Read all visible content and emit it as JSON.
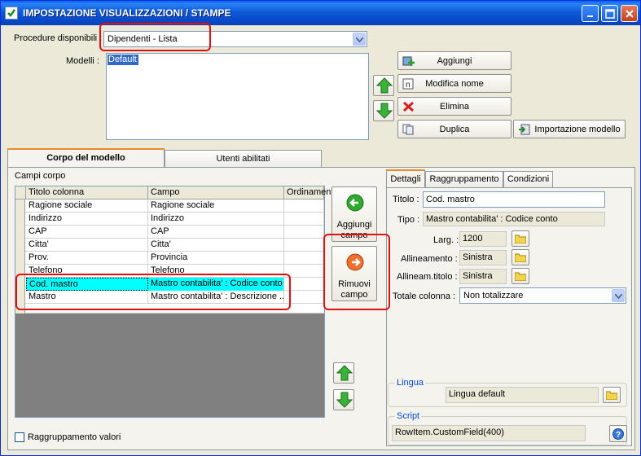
{
  "window": {
    "title": "IMPOSTAZIONE VISUALIZZAZIONI / STAMPE",
    "icon": "checkbox-icon"
  },
  "procedure": {
    "label": "Procedure disponibili :",
    "value": "Dipendenti - Lista"
  },
  "modelli": {
    "label": "Modelli :",
    "items": [
      "Default"
    ]
  },
  "buttons": {
    "aggiungi": "Aggiungi",
    "modifica_nome": "Modifica nome",
    "elimina": "Elimina",
    "duplica": "Duplica",
    "importazione": "Importazione modello"
  },
  "tabs": [
    "Corpo del modello",
    "Utenti abilitati"
  ],
  "campi": {
    "label": "Campi corpo",
    "columns": [
      "Titolo colonna",
      "Campo",
      "Ordinamento"
    ],
    "rows": [
      [
        "Ragione sociale",
        "Ragione sociale",
        ""
      ],
      [
        "Indirizzo",
        "Indirizzo",
        ""
      ],
      [
        "CAP",
        "CAP",
        ""
      ],
      [
        "Citta'",
        "Citta'",
        ""
      ],
      [
        "Prov.",
        "Provincia",
        ""
      ],
      [
        "Telefono",
        "Telefono",
        ""
      ],
      [
        "Cod. mastro",
        "Mastro contabilita' : Codice conto",
        ""
      ],
      [
        "Mastro",
        "Mastro contabilita' : Descrizione ...",
        ""
      ]
    ]
  },
  "actions": {
    "aggiungi_campo": [
      "Aggiungi",
      "campo"
    ],
    "rimuovi_campo": [
      "Rimuovi",
      "campo"
    ]
  },
  "raggruppamento_valori": "Raggruppamento valori",
  "detail_tabs": [
    "Dettagli",
    "Raggruppamento",
    "Condizioni"
  ],
  "dettagli": {
    "titolo_label": "Titolo :",
    "titolo_value": "Cod. mastro",
    "tipo_label": "Tipo :",
    "tipo_value": "Mastro contabilita' : Codice conto",
    "larg_label": "Larg. :",
    "larg_value": "1200",
    "allineamento_label": "Allineamento :",
    "allineamento_value": "Sinistra",
    "allineam_titolo_label": "Allineam.titolo :",
    "allineam_titolo_value": "Sinistra",
    "totale_label": "Totale colonna :",
    "totale_value": "Non totalizzare"
  },
  "lingua": {
    "title": "Lingua",
    "value": "Lingua default"
  },
  "script": {
    "title": "Script",
    "value": "RowItem.CustomField(400)"
  },
  "colors": {
    "selected_row": "#00ffff",
    "highlight": "#e01010",
    "titlebar": "#0a5ff0"
  }
}
